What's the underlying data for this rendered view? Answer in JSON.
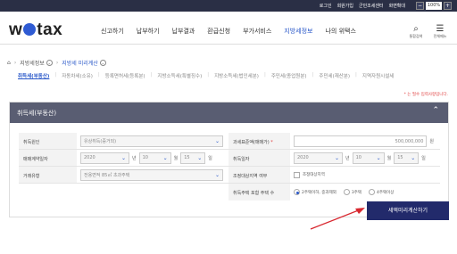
{
  "util_bar": {
    "links": [
      "로그인",
      "회원가입",
      "군민조세센터",
      "화면확대"
    ],
    "zoom_minus": "−",
    "zoom_value": "100%",
    "zoom_plus": "+"
  },
  "header": {
    "logo_left": "w",
    "logo_right": "tax",
    "nav": [
      "신고하기",
      "납부하기",
      "납부결과",
      "환급신청",
      "부가서비스",
      "지방세정보",
      "나의 위택스"
    ],
    "active_nav": "지방세정보",
    "search_label": "통합검색",
    "menu_label": "전체메뉴"
  },
  "breadcrumb": {
    "home": "⌂",
    "item1": "지방세정보",
    "item2": "지방세 미리계산"
  },
  "tabs": [
    "취득세(부동산)",
    "자동차세(소유)",
    "등록면허세(등록분)",
    "지방소득세(특별징수)",
    "지방소득세(법인세분)",
    "주민세(종업원분)",
    "주민세(재산분)",
    "지역자원시설세"
  ],
  "required_note": "* 는 필수 입력사항입니다.",
  "panel": {
    "title": "취득세(부동산)",
    "collapse_icon": "⌃",
    "rows": {
      "r1": {
        "label1": "취득원인",
        "select1": "유상취득(증거외)",
        "label2": "과세표준액(매매가)",
        "required_mark": "*",
        "amount": "500,000,000",
        "amount_unit": "원"
      },
      "r2": {
        "label1": "매매계약일자",
        "year": "2020",
        "year_unit": "년",
        "month": "10",
        "month_unit": "월",
        "day": "15",
        "day_unit": "일",
        "label2": "취득일자",
        "year2": "2020",
        "month2": "10",
        "day2": "15"
      },
      "r3": {
        "label1": "거래유형",
        "select1": "전용면적 85㎡ 초과주택",
        "label2": "조정대상지역 여부",
        "checkbox_label": "조정대상지역"
      },
      "r4": {
        "label2": "취득주택 포함 주택 수",
        "options": [
          "2주택이하, 중과제외",
          "3주택",
          "4주택이상"
        ],
        "selected": 0
      }
    }
  },
  "calc_button": "세액미리계산하기",
  "colors": {
    "accent": "#2a58c9",
    "panel_header": "#595d72",
    "button": "#222a6b",
    "arrow": "#d8272f"
  }
}
